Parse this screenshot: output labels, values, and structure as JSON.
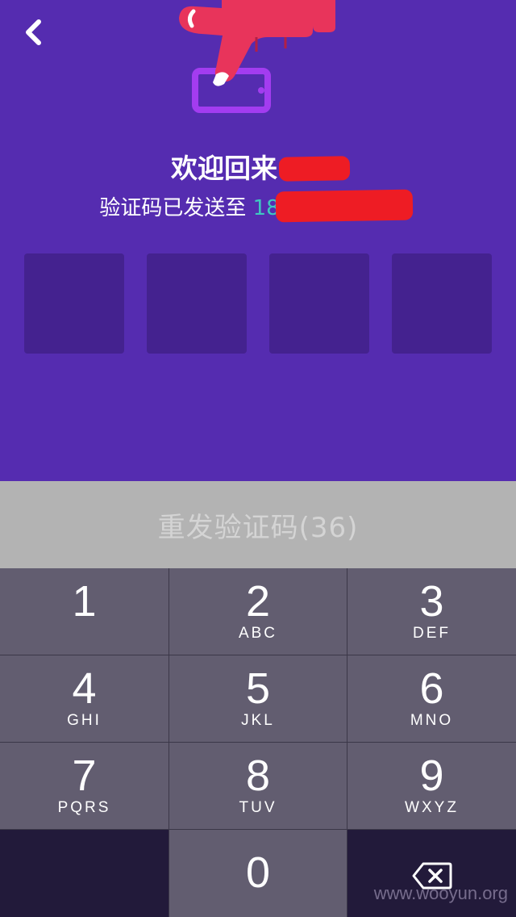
{
  "header": {
    "back_icon": "chevron-left-icon",
    "illustration_icon": "finger-tap-phone-icon"
  },
  "welcome": {
    "title": "欢迎回来",
    "subtitle": "验证码已发送至",
    "phone_visible": "18"
  },
  "code": {
    "digits": [
      "",
      "",
      "",
      ""
    ]
  },
  "resend": {
    "label": "重发验证码(36)"
  },
  "keypad": {
    "keys": [
      {
        "num": "1",
        "letters": ""
      },
      {
        "num": "2",
        "letters": "ABC"
      },
      {
        "num": "3",
        "letters": "DEF"
      },
      {
        "num": "4",
        "letters": "GHI"
      },
      {
        "num": "5",
        "letters": "JKL"
      },
      {
        "num": "6",
        "letters": "MNO"
      },
      {
        "num": "7",
        "letters": "PQRS"
      },
      {
        "num": "8",
        "letters": "TUV"
      },
      {
        "num": "9",
        "letters": "WXYZ"
      },
      {
        "num": "0",
        "letters": ""
      }
    ],
    "delete_icon": "backspace-icon"
  },
  "watermark": "www.wooyun.org",
  "colors": {
    "background": "#552cb0",
    "code_box": "#44228f",
    "phone": "#3ec8c0",
    "redaction": "#ee1c24",
    "resend_bg": "#b3b3b3",
    "key": "#625d70"
  }
}
